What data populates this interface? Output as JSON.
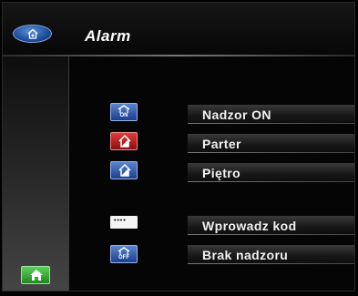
{
  "header": {
    "title": "Alarm",
    "app_icon": "alarm-icon",
    "accent": "#2d5fb3"
  },
  "sidebar": {
    "home_icon": "home-icon",
    "home_color": "#35a834"
  },
  "menu": {
    "items": [
      {
        "label": "Nadzor ON",
        "icon": "house-on-icon",
        "icon_text": "ON",
        "icon_color": "#2d5fb3"
      },
      {
        "label": "Parter",
        "icon": "house-ground-floor-icon",
        "icon_color": "#c41e1e"
      },
      {
        "label": "Piętro",
        "icon": "house-upper-floor-icon",
        "icon_color": "#2d5fb3"
      },
      {
        "label": "Wprowadz kod",
        "icon": "keypad-icon",
        "icon_color": "#f4f4f4"
      },
      {
        "label": "Brak nadzoru",
        "icon": "house-off-icon",
        "icon_text": "OFF",
        "icon_color": "#2d5fb3"
      }
    ]
  }
}
